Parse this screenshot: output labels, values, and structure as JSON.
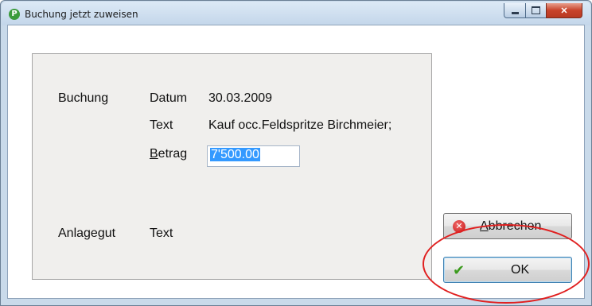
{
  "window": {
    "title": "Buchung jetzt zuweisen",
    "icon": "app-p-icon",
    "controls": [
      "minimize-icon",
      "maximize-icon",
      "close-icon"
    ]
  },
  "booking": {
    "section_label": "Buchung",
    "date_label": "Datum",
    "date_value": "30.03.2009",
    "text_label": "Text",
    "text_value": "Kauf occ.Feldspritze Birchmeier;",
    "amount_label_accel": "B",
    "amount_label_rest": "etrag",
    "amount_value": "7'500.00"
  },
  "asset": {
    "section_label": "Anlagegut",
    "text_label": "Text"
  },
  "buttons": {
    "cancel_accel": "A",
    "cancel_rest": "bbrechen",
    "ok_label": "OK"
  },
  "colors": {
    "highlight": "#e02020",
    "selection": "#3399ff"
  }
}
